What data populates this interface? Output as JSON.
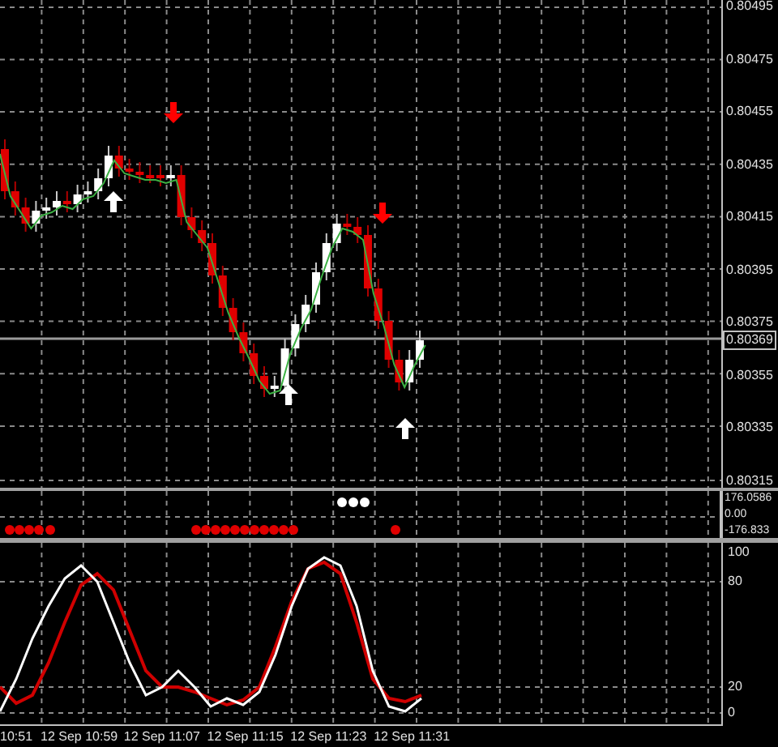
{
  "price_axis": {
    "labels": [
      "0.80495",
      "0.80475",
      "0.80455",
      "0.80435",
      "0.80415",
      "0.80395",
      "0.80375",
      "0.80355",
      "0.80335",
      "0.80315"
    ],
    "current_price": "0.80369"
  },
  "indicator_axis": {
    "labels": [
      "176.0586",
      "0.00",
      "-176.833"
    ]
  },
  "stochastic_axis": {
    "labels": [
      "100",
      "80",
      "20",
      "0"
    ]
  },
  "time_axis": {
    "labels": [
      "10:51",
      "12 Sep 10:59",
      "12 Sep 11:07",
      "12 Sep 11:15",
      "12 Sep 11:23",
      "12 Sep 11:31"
    ]
  }
}
